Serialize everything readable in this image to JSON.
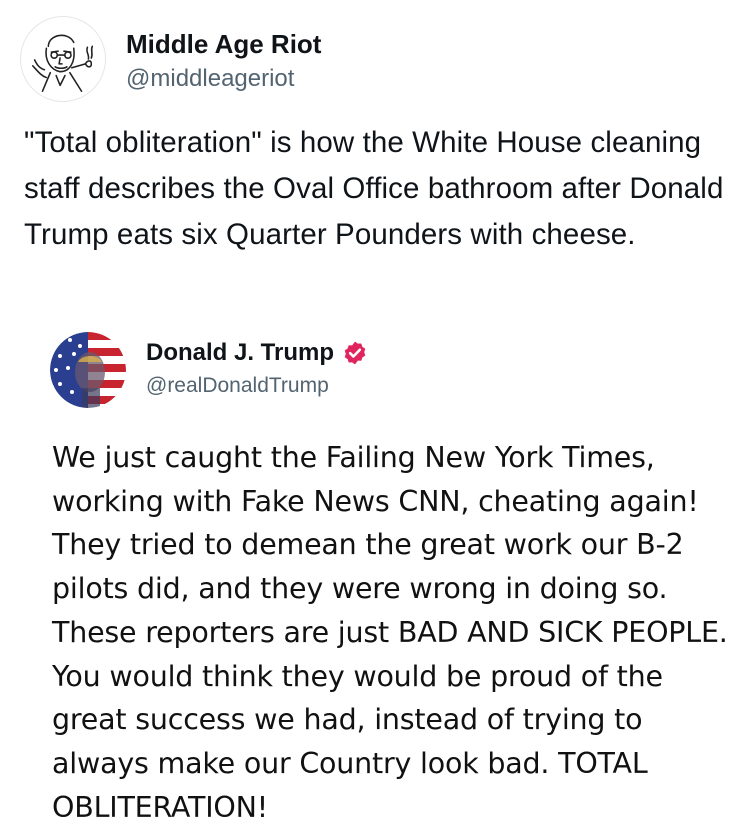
{
  "tweet": {
    "author_name": "Middle Age Riot",
    "author_handle": "@middleageriot",
    "avatar_icon": "sketch-man-portrait-icon",
    "text": "\"Total obliteration\" is how the White House cleaning staff describes the Oval Office bathroom after Donald Trump eats six Quarter Pounders with cheese."
  },
  "quoted_post": {
    "author_name": "Donald J. Trump",
    "author_handle": "@realDonaldTrump",
    "avatar_icon": "flag-portrait-icon",
    "badge_icon": "verified-badge-icon",
    "badge_color": "#e0245e",
    "text": "We just caught the Failing New York Times, working with Fake News CNN, cheating again! They tried to demean the great work our B-2 pilots did, and they were wrong in doing so. These reporters are just BAD AND SICK PEOPLE. You would think they would be proud of the great success we had, instead of trying to always make our Country look bad. TOTAL OBLITERATION!"
  }
}
